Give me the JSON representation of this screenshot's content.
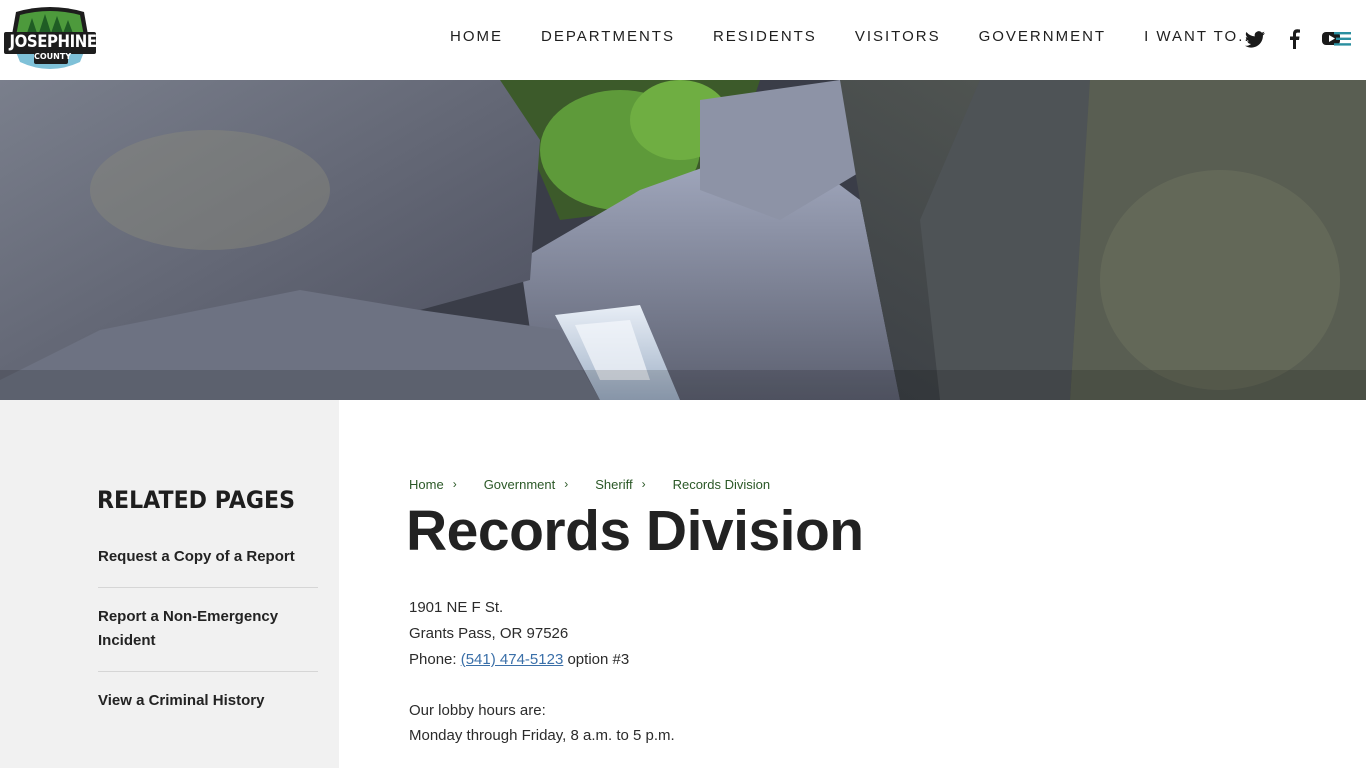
{
  "header": {
    "logo": {
      "top_text": "JOSEPHINE",
      "bottom_text": "COUNTY"
    },
    "nav": [
      "HOME",
      "DEPARTMENTS",
      "RESIDENTS",
      "VISITORS",
      "GOVERNMENT",
      "I WANT TO..."
    ],
    "social": [
      "twitter-icon",
      "facebook-icon",
      "youtube-icon"
    ],
    "menu_icon": "hamburger-icon"
  },
  "colors": {
    "accent_green": "#2b5827",
    "link_blue": "#3a6fa8",
    "sidebar_bg": "#f1f1f1"
  },
  "sidebar": {
    "title": "RELATED PAGES",
    "links": [
      "Request a Copy of a Report",
      "Report a Non-Emergency Incident",
      "View a Criminal History"
    ]
  },
  "breadcrumb": {
    "items": [
      "Home",
      "Government",
      "Sheriff"
    ],
    "current": "Records Division"
  },
  "main": {
    "title": "Records Division",
    "address_line1": "1901 NE F St.",
    "address_line2": "Grants Pass, OR 97526",
    "phone_label": "Phone:",
    "phone_number": "(541) 474-5123",
    "phone_suffix": "option #3",
    "lobby_intro": "Our lobby hours are:",
    "lobby_hours": "Monday through Friday, 8 a.m. to 5 p.m."
  }
}
